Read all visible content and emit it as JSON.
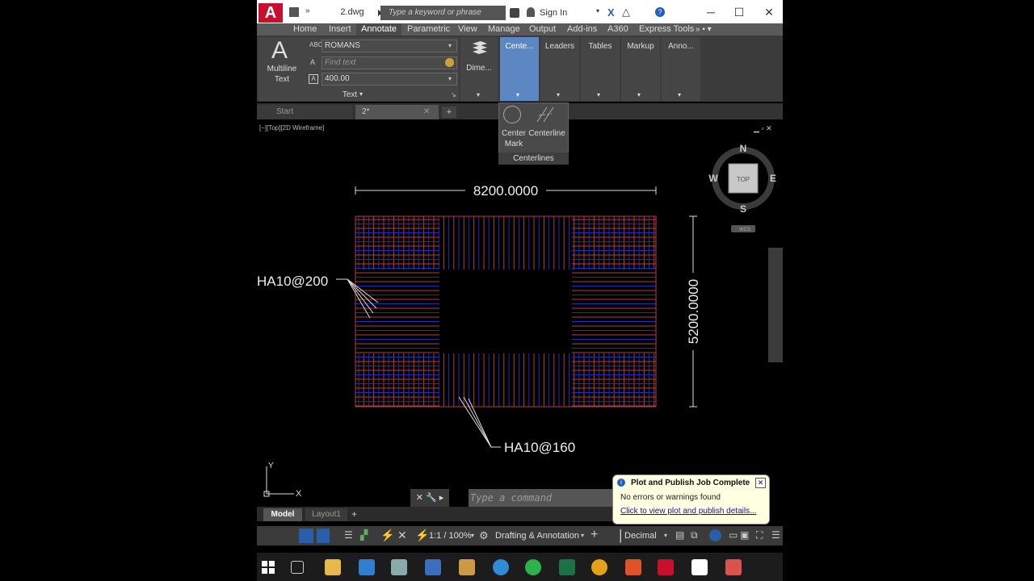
{
  "window": {
    "title": "2.dwg",
    "search_placeholder": "Type a keyword or phrase",
    "sign_in": "Sign In"
  },
  "menu_tabs": [
    "Home",
    "Insert",
    "Annotate",
    "Parametric",
    "View",
    "Manage",
    "Output",
    "Add-ins",
    "A360",
    "Express Tools"
  ],
  "ribbon": {
    "multiline_text_label_1": "Multiline",
    "multiline_text_label_2": "Text",
    "font_value": "ROMANS",
    "find_text_placeholder": "Find text",
    "height_value": "400.00",
    "text_panel_label": "Text",
    "dim_label": "Dime...",
    "panels": [
      "Cente...",
      "Leaders",
      "Tables",
      "Markup",
      "Anno..."
    ]
  },
  "centerlines_popup": {
    "center_mark_1": "Center",
    "center_mark_2": "Mark",
    "centerline": "Centerline",
    "title": "Centerlines"
  },
  "doc_tabs": [
    "Start",
    "2*"
  ],
  "viewport_label": "[−][Top][2D Wireframe]",
  "drawing": {
    "dim_horizontal": "8200.0000",
    "dim_vertical": "5200.0000",
    "label_left": "HA10@200",
    "label_bottom": "HA10@160"
  },
  "viewcube": {
    "n": "N",
    "s": "S",
    "e": "E",
    "w": "W",
    "top": "TOP",
    "wcs": "WCS"
  },
  "ucs": {
    "x": "X",
    "y": "Y"
  },
  "command": {
    "placeholder": "Type a command"
  },
  "notification": {
    "title": "Plot and Publish Job Complete",
    "message": "No errors or warnings found",
    "link": "Click to view plot and publish details..."
  },
  "layout_tabs": [
    "Model",
    "Layout1"
  ],
  "status": {
    "scale": "1:1 / 100%",
    "workspace": "Drafting & Annotation",
    "units": "Decimal"
  },
  "colors": {
    "rebar_red": "#b83a3a",
    "rebar_blue": "#2a2ab8",
    "accent_blue": "#5d87c2"
  }
}
